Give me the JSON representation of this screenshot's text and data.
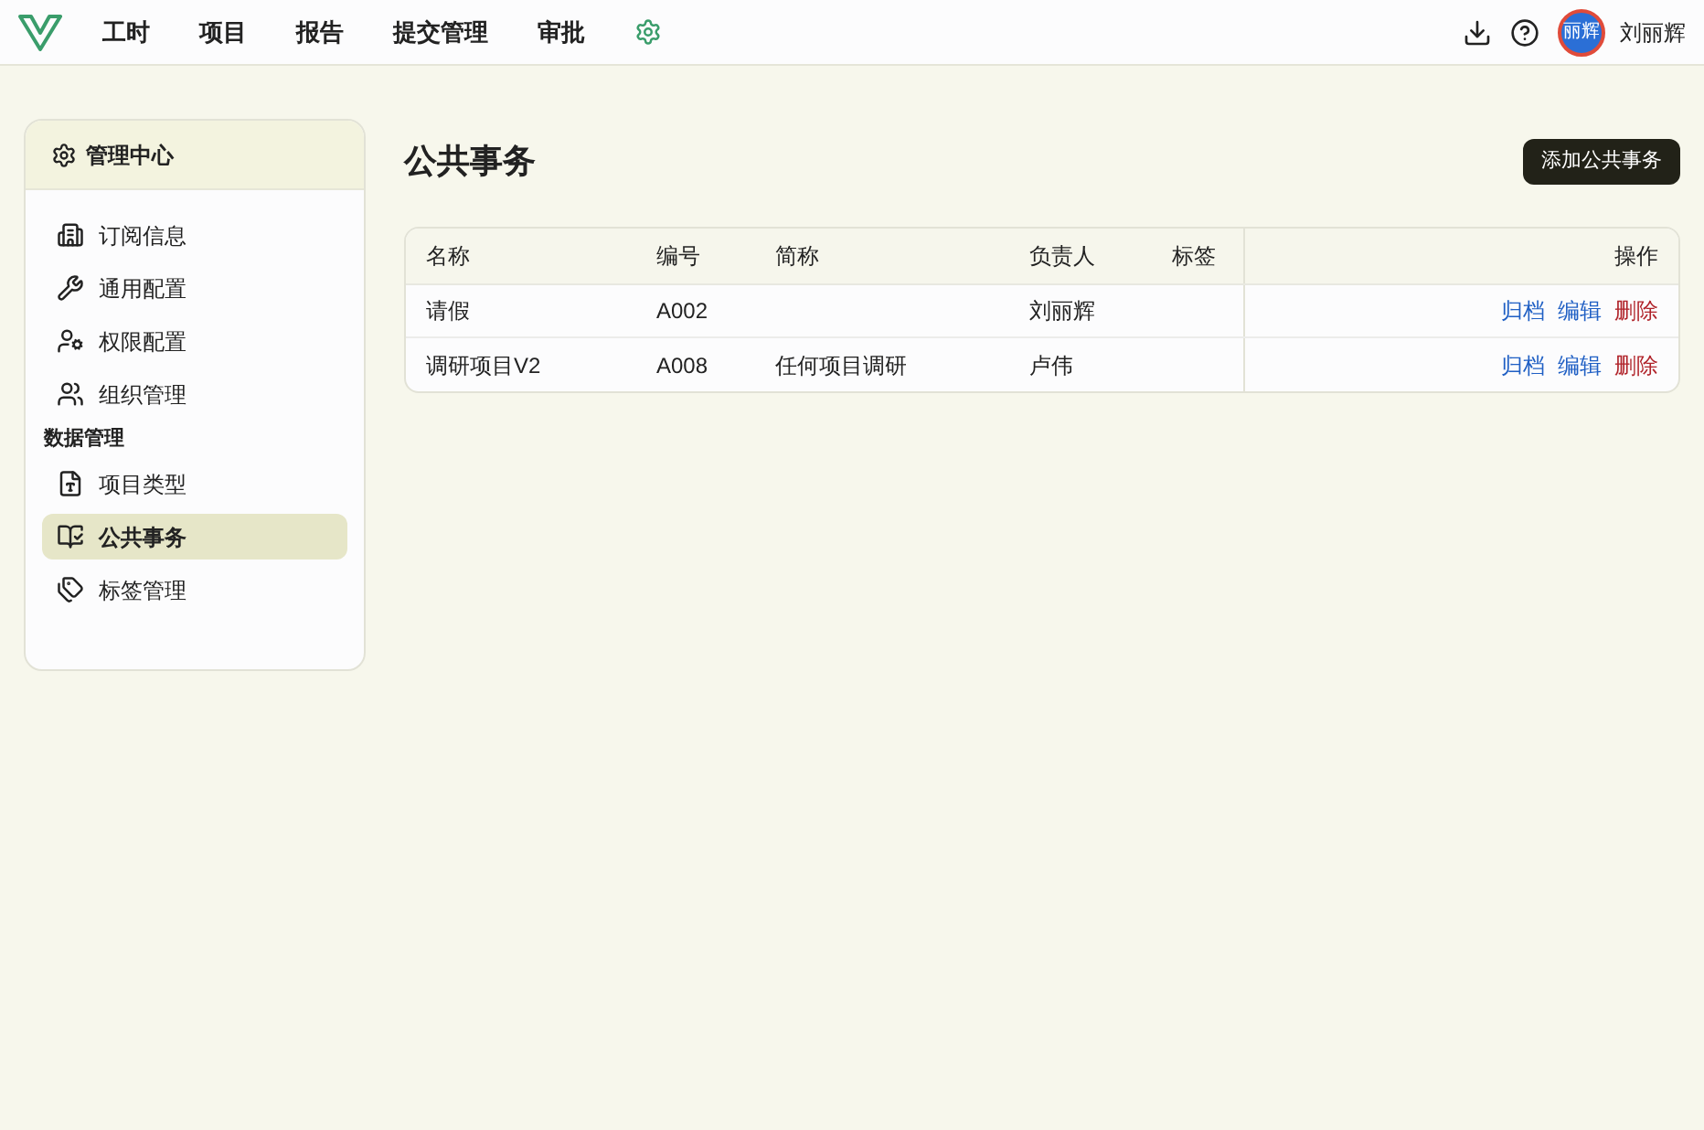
{
  "nav": {
    "items": [
      {
        "label": "工时",
        "selected": false
      },
      {
        "label": "项目",
        "selected": false
      },
      {
        "label": "报告",
        "selected": false
      },
      {
        "label": "提交管理",
        "selected": false
      },
      {
        "label": "审批",
        "selected": false
      }
    ],
    "settings_selected": true,
    "avatar_text": "丽辉",
    "user_name": "刘丽辉"
  },
  "sidebar": {
    "title": "管理中心",
    "groups": [
      {
        "items": [
          {
            "label": "订阅信息",
            "selected": false
          },
          {
            "label": "通用配置",
            "selected": false
          },
          {
            "label": "权限配置",
            "selected": false
          },
          {
            "label": "组织管理",
            "selected": false
          }
        ]
      },
      {
        "label": "数据管理",
        "items": [
          {
            "label": "项目类型",
            "selected": false
          },
          {
            "label": "公共事务",
            "selected": true
          },
          {
            "label": "标签管理",
            "selected": false
          }
        ]
      }
    ]
  },
  "page": {
    "title": "公共事务",
    "add_button": "添加公共事务"
  },
  "table": {
    "columns": [
      "名称",
      "编号",
      "简称",
      "负责人",
      "标签",
      "操作"
    ],
    "rows": [
      {
        "cells": [
          "请假",
          "A002",
          "",
          "刘丽辉",
          ""
        ],
        "actions": [
          "归档",
          "编辑",
          "删除"
        ]
      },
      {
        "cells": [
          "调研项目V2",
          "A008",
          "任何项目调研",
          "卢伟",
          ""
        ],
        "actions": [
          "归档",
          "编辑",
          "删除"
        ]
      }
    ]
  }
}
